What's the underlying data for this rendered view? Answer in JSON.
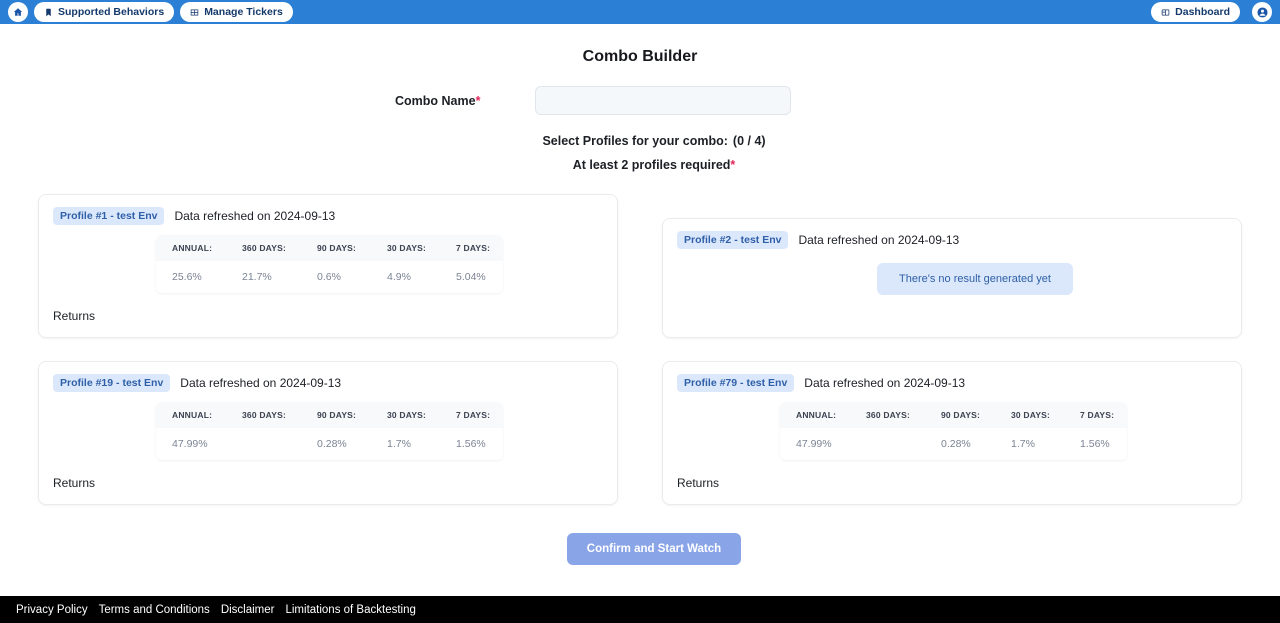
{
  "header": {
    "home_icon": "home-icon",
    "nav_items": [
      {
        "label": "Supported Behaviors",
        "icon": "bookmark-icon"
      },
      {
        "label": "Manage Tickers",
        "icon": "table-icon"
      }
    ],
    "right_items": [
      {
        "label": "Dashboard",
        "icon": "dashboard-grid-icon"
      }
    ],
    "avatar_icon": "user-avatar-icon",
    "background_color": "#2b7fd4"
  },
  "page": {
    "title": "Combo Builder"
  },
  "form": {
    "combo_name_label": "Combo Name",
    "required_marker": "*",
    "combo_name_value": "",
    "combo_name_placeholder": "",
    "select_profiles_label": "Select Profiles for your combo:",
    "select_profiles_count": "(0 / 4)",
    "at_least_label": "At least 2 profiles required"
  },
  "stats_columns": [
    "ANNUAL:",
    "360 DAYS:",
    "90 DAYS:",
    "30 DAYS:",
    "7 DAYS:"
  ],
  "cards": [
    {
      "badge": "Profile #1 - test Env",
      "refreshed": "Data refreshed on 2024-09-13",
      "has_stats": true,
      "values": [
        "25.6%",
        "21.7%",
        "0.6%",
        "4.9%",
        "5.04%"
      ],
      "returns_label": "Returns"
    },
    {
      "badge": "Profile #2 - test Env",
      "refreshed": "Data refreshed on 2024-09-13",
      "has_stats": false,
      "empty_message": "There's no result generated yet"
    },
    {
      "badge": "Profile #19 - test Env",
      "refreshed": "Data refreshed on 2024-09-13",
      "has_stats": true,
      "values": [
        "47.99%",
        "",
        "0.28%",
        "1.7%",
        "1.56%"
      ],
      "returns_label": "Returns"
    },
    {
      "badge": "Profile #79 - test Env",
      "refreshed": "Data refreshed on 2024-09-13",
      "has_stats": true,
      "values": [
        "47.99%",
        "",
        "0.28%",
        "1.7%",
        "1.56%"
      ],
      "returns_label": "Returns"
    }
  ],
  "actions": {
    "confirm_label": "Confirm and Start Watch",
    "confirm_color": "#8aa4e8"
  },
  "footer": {
    "links": [
      "Privacy Policy",
      "Terms and Conditions",
      "Disclaimer",
      "Limitations of Backtesting"
    ]
  },
  "colors": {
    "header_blue": "#2b7fd4",
    "badge_blue_bg": "#dbe8fb",
    "badge_blue_text": "#2f5fa8",
    "required_red": "#e0285a",
    "footer_black": "#000000"
  }
}
